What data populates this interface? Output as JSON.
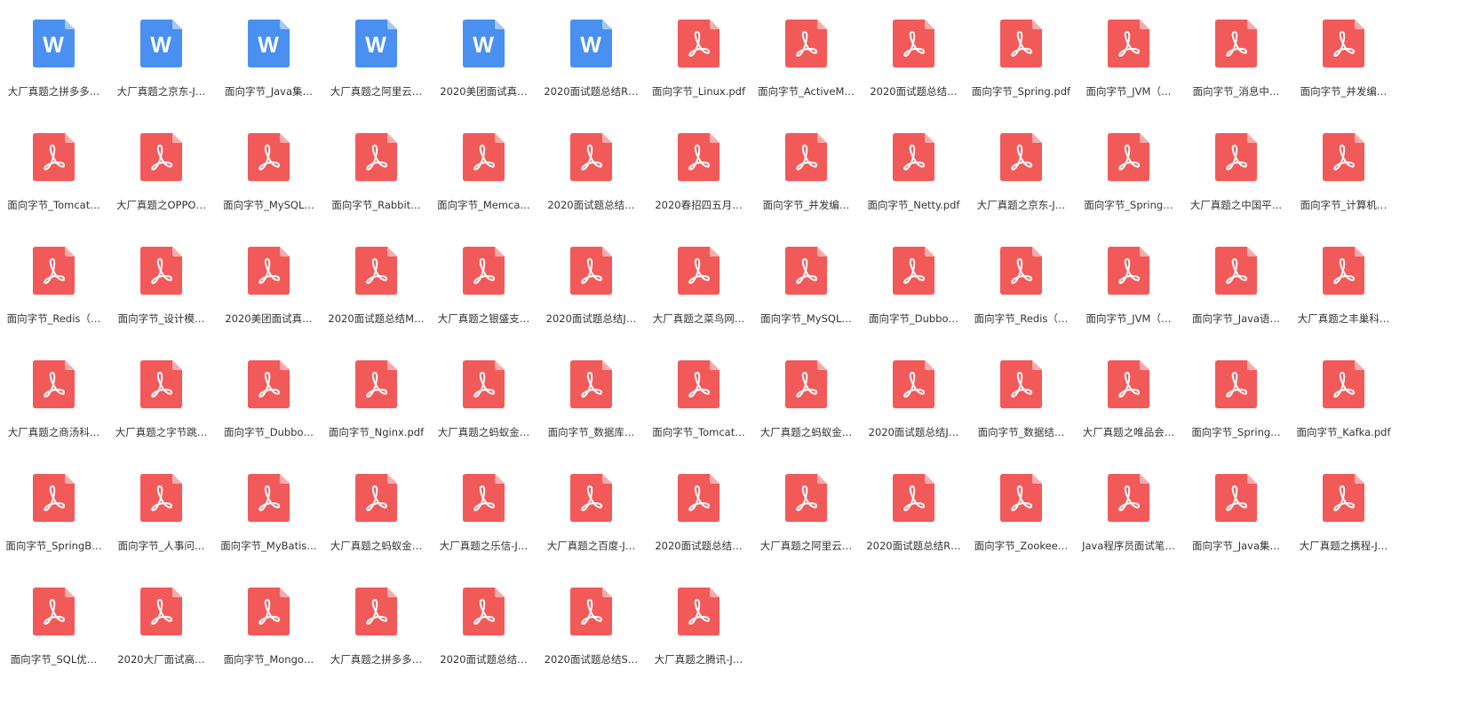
{
  "colors": {
    "word": "#4a90f0",
    "word_fold": "#a6c8f8",
    "pdf": "#f25a5a",
    "pdf_fold": "#f9abab",
    "glyph": "#ffffff",
    "label_text": "#333333"
  },
  "icons": {
    "word": "word-doc-icon",
    "pdf": "pdf-icon"
  },
  "files": [
    {
      "name": "大厂真题之拼多多…",
      "type": "word"
    },
    {
      "name": "大厂真题之京东-J…",
      "type": "word"
    },
    {
      "name": "面向字节_Java集…",
      "type": "word"
    },
    {
      "name": "大厂真题之阿里云…",
      "type": "word"
    },
    {
      "name": "2020美团面试真…",
      "type": "word"
    },
    {
      "name": "2020面试题总结R…",
      "type": "word"
    },
    {
      "name": "面向字节_Linux.pdf",
      "type": "pdf"
    },
    {
      "name": "面向字节_ActiveM…",
      "type": "pdf"
    },
    {
      "name": "2020面试题总结…",
      "type": "pdf"
    },
    {
      "name": "面向字节_Spring.pdf",
      "type": "pdf"
    },
    {
      "name": "面向字节_JVM（…",
      "type": "pdf"
    },
    {
      "name": "面向字节_消息中…",
      "type": "pdf"
    },
    {
      "name": "面向字节_并发编…",
      "type": "pdf"
    },
    {
      "name": "面向字节_Tomcat…",
      "type": "pdf"
    },
    {
      "name": "大厂真题之OPPO…",
      "type": "pdf"
    },
    {
      "name": "面向字节_MySQL…",
      "type": "pdf"
    },
    {
      "name": "面向字节_Rabbit…",
      "type": "pdf"
    },
    {
      "name": "面向字节_Memca…",
      "type": "pdf"
    },
    {
      "name": "2020面试题总结…",
      "type": "pdf"
    },
    {
      "name": "2020春招四五月…",
      "type": "pdf"
    },
    {
      "name": "面向字节_并发编…",
      "type": "pdf"
    },
    {
      "name": "面向字节_Netty.pdf",
      "type": "pdf"
    },
    {
      "name": "大厂真题之京东-J…",
      "type": "pdf"
    },
    {
      "name": "面向字节_Spring…",
      "type": "pdf"
    },
    {
      "name": "大厂真题之中国平…",
      "type": "pdf"
    },
    {
      "name": "面向字节_计算机…",
      "type": "pdf"
    },
    {
      "name": "面向字节_Redis（…",
      "type": "pdf"
    },
    {
      "name": "面向字节_设计模…",
      "type": "pdf"
    },
    {
      "name": "2020美团面试真…",
      "type": "pdf"
    },
    {
      "name": "2020面试题总结M…",
      "type": "pdf"
    },
    {
      "name": "大厂真题之银盛支…",
      "type": "pdf"
    },
    {
      "name": "2020面试题总结J…",
      "type": "pdf"
    },
    {
      "name": "大厂真题之菜鸟网…",
      "type": "pdf"
    },
    {
      "name": "面向字节_MySQL…",
      "type": "pdf"
    },
    {
      "name": "面向字节_Dubbo…",
      "type": "pdf"
    },
    {
      "name": "面向字节_Redis（…",
      "type": "pdf"
    },
    {
      "name": "面向字节_JVM（…",
      "type": "pdf"
    },
    {
      "name": "面向字节_Java语…",
      "type": "pdf"
    },
    {
      "name": "大厂真题之丰巢科…",
      "type": "pdf"
    },
    {
      "name": "大厂真题之商汤科…",
      "type": "pdf"
    },
    {
      "name": "大厂真题之字节跳…",
      "type": "pdf"
    },
    {
      "name": "面向字节_Dubbo…",
      "type": "pdf"
    },
    {
      "name": "面向字节_Nginx.pdf",
      "type": "pdf"
    },
    {
      "name": "大厂真题之蚂蚁金…",
      "type": "pdf"
    },
    {
      "name": "面向字节_数据库…",
      "type": "pdf"
    },
    {
      "name": "面向字节_Tomcat…",
      "type": "pdf"
    },
    {
      "name": "大厂真题之蚂蚁金…",
      "type": "pdf"
    },
    {
      "name": "2020面试题总结J…",
      "type": "pdf"
    },
    {
      "name": "面向字节_数据结…",
      "type": "pdf"
    },
    {
      "name": "大厂真题之唯品会…",
      "type": "pdf"
    },
    {
      "name": "面向字节_Spring…",
      "type": "pdf"
    },
    {
      "name": "面向字节_Kafka.pdf",
      "type": "pdf"
    },
    {
      "name": "面向字节_SpringB…",
      "type": "pdf"
    },
    {
      "name": "面向字节_人事问…",
      "type": "pdf"
    },
    {
      "name": "面向字节_MyBatis…",
      "type": "pdf"
    },
    {
      "name": "大厂真题之蚂蚁金…",
      "type": "pdf"
    },
    {
      "name": "大厂真题之乐信-J…",
      "type": "pdf"
    },
    {
      "name": "大厂真题之百度-J…",
      "type": "pdf"
    },
    {
      "name": "2020面试题总结…",
      "type": "pdf"
    },
    {
      "name": "大厂真题之阿里云…",
      "type": "pdf"
    },
    {
      "name": "2020面试题总结R…",
      "type": "pdf"
    },
    {
      "name": "面向字节_Zookee…",
      "type": "pdf"
    },
    {
      "name": "Java程序员面试笔…",
      "type": "pdf"
    },
    {
      "name": "面向字节_Java集…",
      "type": "pdf"
    },
    {
      "name": "大厂真题之携程-J…",
      "type": "pdf"
    },
    {
      "name": "面向字节_SQL优…",
      "type": "pdf"
    },
    {
      "name": "2020大厂面试高…",
      "type": "pdf"
    },
    {
      "name": "面向字节_Mongo…",
      "type": "pdf"
    },
    {
      "name": "大厂真题之拼多多…",
      "type": "pdf"
    },
    {
      "name": "2020面试题总结…",
      "type": "pdf"
    },
    {
      "name": "2020面试题总结S…",
      "type": "pdf"
    },
    {
      "name": "大厂真题之腾讯-J…",
      "type": "pdf"
    }
  ]
}
